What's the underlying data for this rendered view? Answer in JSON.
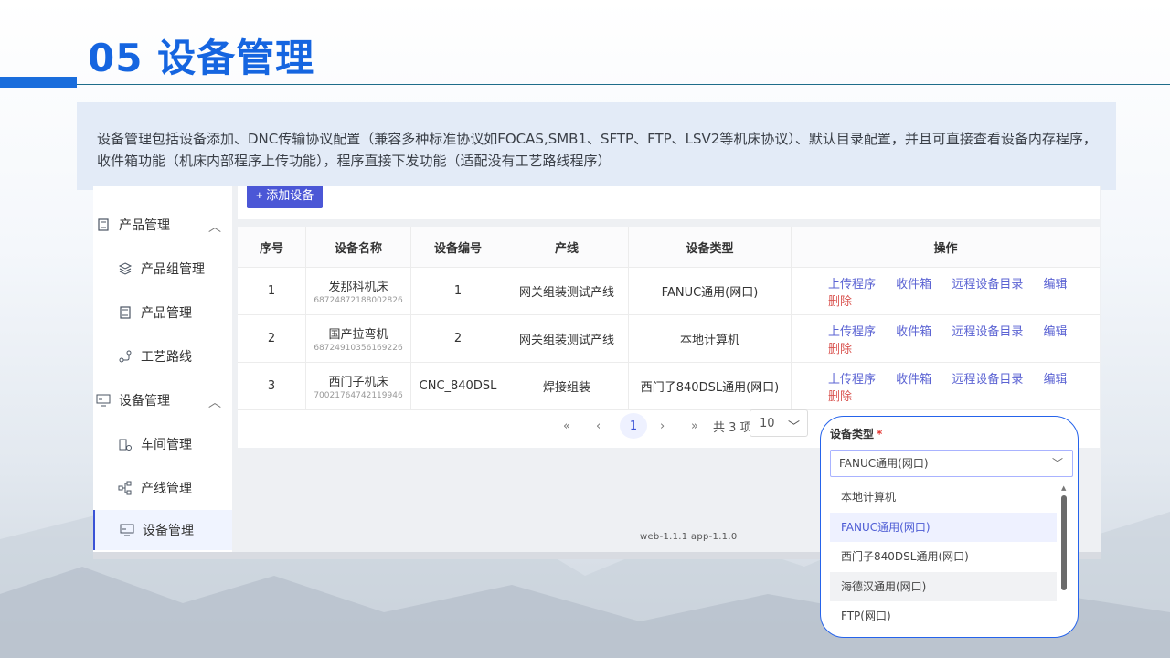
{
  "slide": {
    "title": "05 设备管理",
    "description": "设备管理包括设备添加、DNC传输协议配置（兼容多种标准协议如FOCAS,SMB1、SFTP、FTP、LSV2等机床协议）、默认目录配置，并且可直接查看设备内存程序，收件箱功能（机床内部程序上传功能），程序直接下发功能（适配没有工艺路线程序）"
  },
  "sidebar": {
    "items": [
      {
        "label": "产品管理",
        "icon": "document-icon",
        "type": "group",
        "expanded": true
      },
      {
        "label": "产品组管理",
        "icon": "layers-icon",
        "type": "sub"
      },
      {
        "label": "产品管理",
        "icon": "document-icon",
        "type": "sub"
      },
      {
        "label": "工艺路线",
        "icon": "route-icon",
        "type": "sub"
      },
      {
        "label": "设备管理",
        "icon": "device-icon",
        "type": "group",
        "expanded": true
      },
      {
        "label": "车间管理",
        "icon": "workshop-icon",
        "type": "sub"
      },
      {
        "label": "产线管理",
        "icon": "line-tree-icon",
        "type": "sub"
      },
      {
        "label": "设备管理",
        "icon": "device-icon",
        "type": "sub",
        "active": true
      }
    ]
  },
  "toolbar": {
    "add_label": "+ 添加设备"
  },
  "table": {
    "headers": [
      "序号",
      "设备名称",
      "设备编号",
      "产线",
      "设备类型",
      "操作"
    ],
    "rows": [
      {
        "index": "1",
        "name": "发那科机床",
        "serial": "68724872188002826",
        "code": "1",
        "line": "网关组装测试产线",
        "type": "FANUC通用(网口)"
      },
      {
        "index": "2",
        "name": "国产拉弯机",
        "serial": "68724910356169226",
        "code": "2",
        "line": "网关组装测试产线",
        "type": "本地计算机"
      },
      {
        "index": "3",
        "name": "西门子机床",
        "serial": "70021764742119946",
        "code": "CNC_840DSL",
        "line": "焊接组装",
        "type": "西门子840DSL通用(网口)"
      }
    ],
    "actions": {
      "upload": "上传程序",
      "inbox": "收件箱",
      "remote_dir": "远程设备目录",
      "edit": "编辑",
      "delete": "删除"
    }
  },
  "pagination": {
    "first": "«",
    "prev": "‹",
    "current": "1",
    "next": "›",
    "last": "»",
    "total_text": "共 3 项",
    "page_size": "10"
  },
  "version": "web-1.1.1   app-1.1.0",
  "dropdown": {
    "label": "设备类型",
    "required_mark": "*",
    "selected": "FANUC通用(网口)",
    "options": [
      "本地计算机",
      "FANUC通用(网口)",
      "西门子840DSL通用(网口)",
      "海德汉通用(网口)",
      "FTP(网口)"
    ],
    "selected_index": 1,
    "hover_index": 3
  },
  "colors": {
    "title_blue": "#1565e0",
    "accent": "#4b57d6",
    "danger": "#d9534f",
    "link": "#5b63d3"
  }
}
